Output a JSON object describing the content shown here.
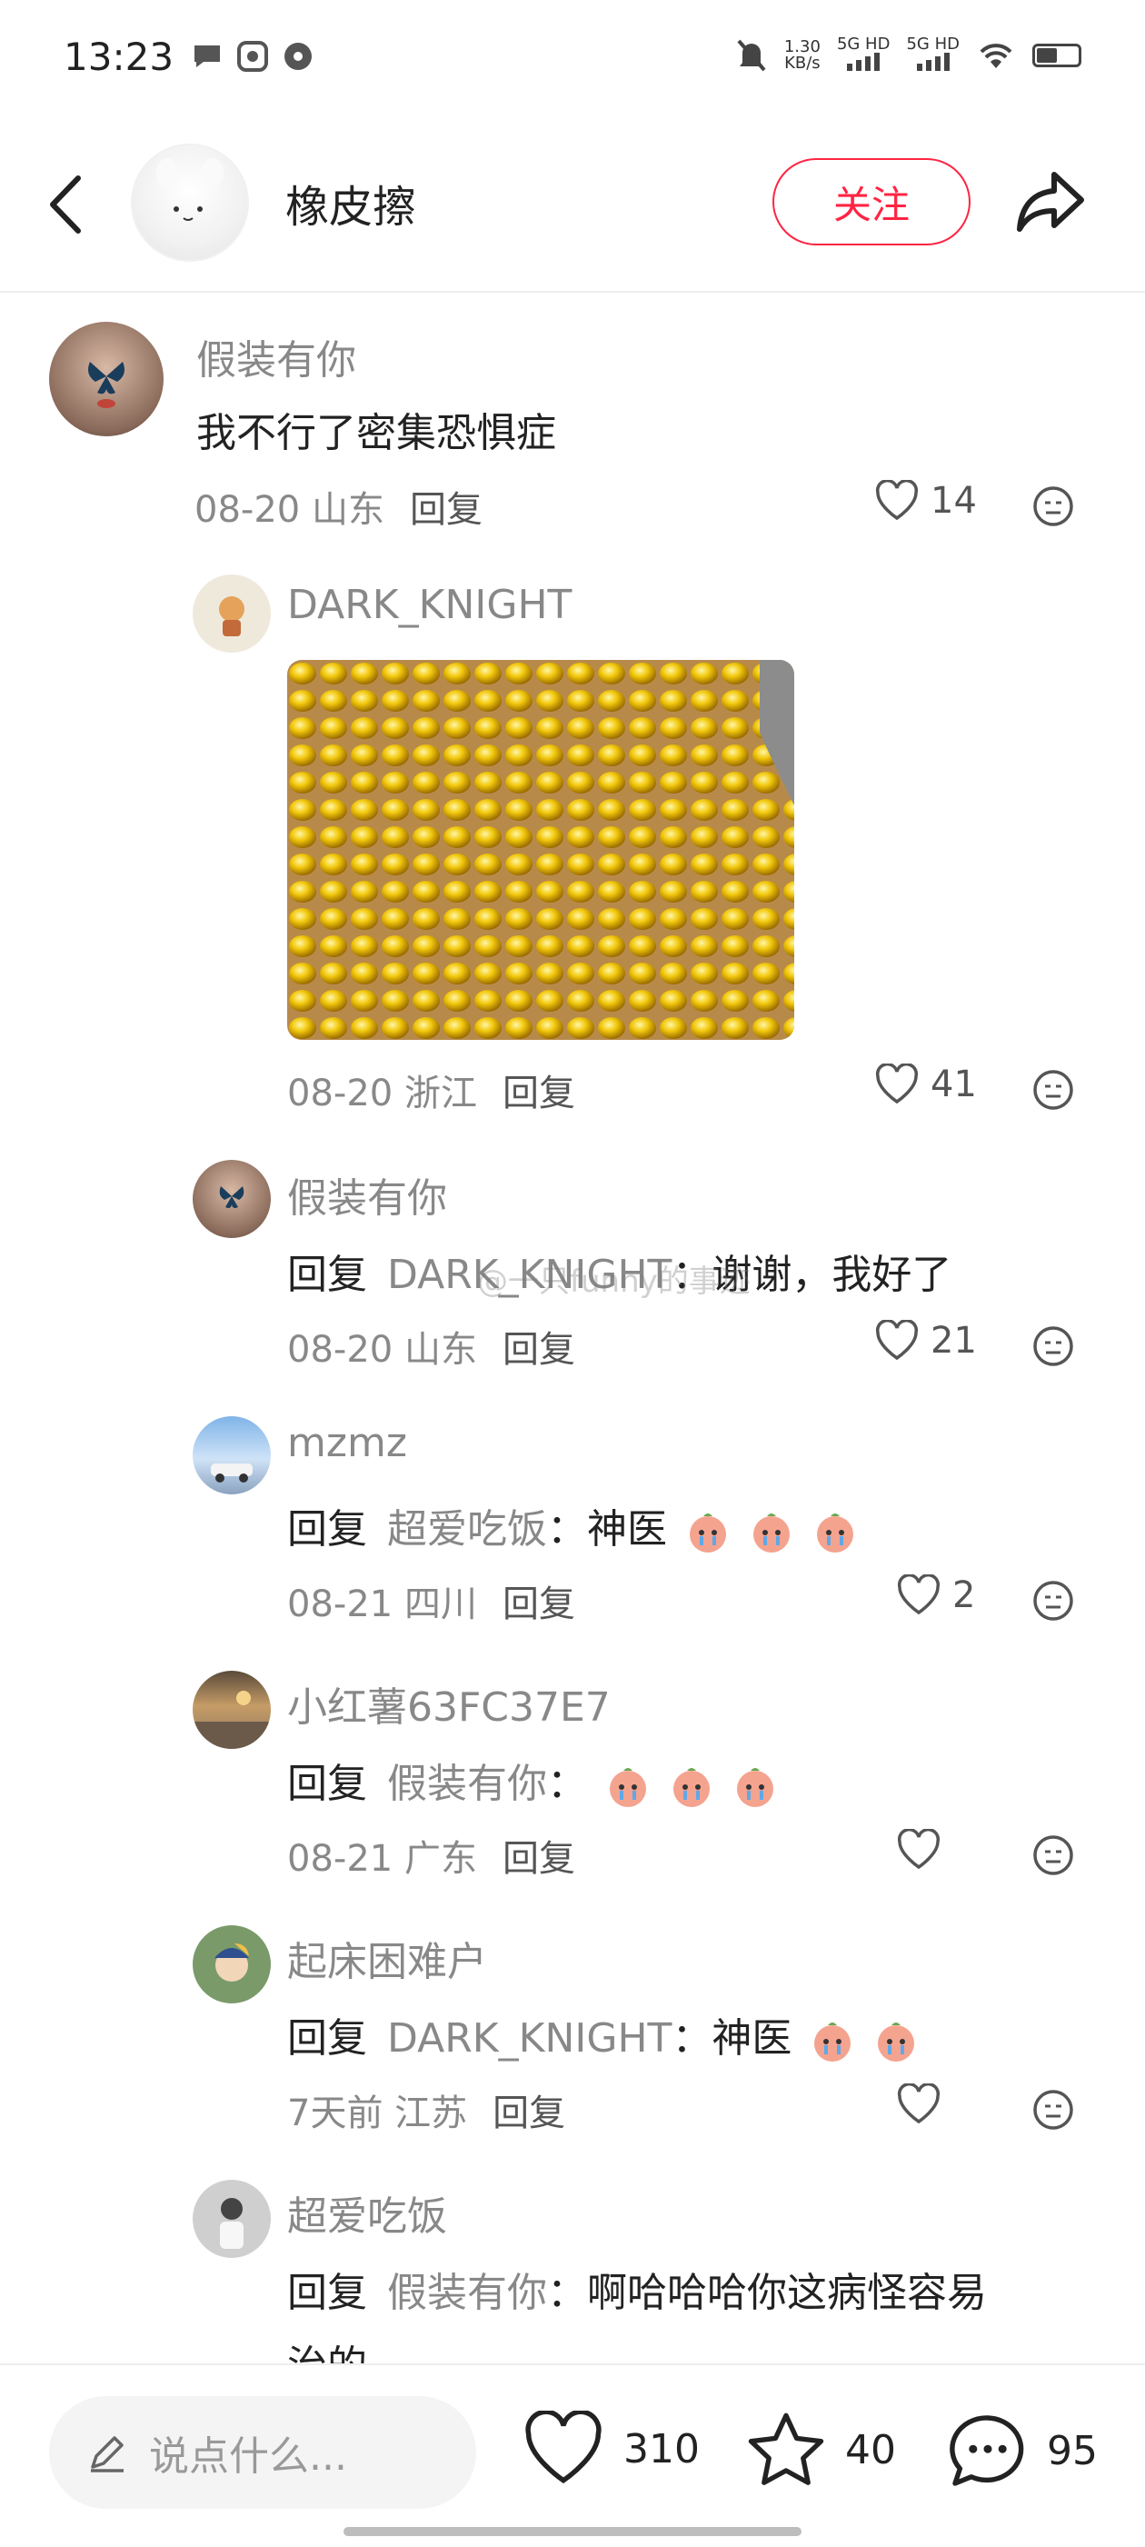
{
  "status_bar": {
    "time": "13:23",
    "speed_value": "1.30",
    "speed_unit": "KB/s",
    "net1": "5G HD",
    "net2": "5G HD",
    "battery_level": 0.45
  },
  "header": {
    "author_name": "橡皮擦",
    "follow_label": "关注"
  },
  "comments": [
    {
      "user": "假装有你",
      "text": "我不行了密集恐惧症",
      "date": "08-20",
      "location": "山东",
      "reply_label": "回复",
      "likes": "14"
    },
    {
      "user": "DARK_KNIGHT",
      "text": "",
      "date": "08-20",
      "location": "浙江",
      "reply_label": "回复",
      "likes": "41"
    },
    {
      "user": "假装有你",
      "reply_prefix": "回复",
      "reply_target": "DARK_KNIGHT",
      "text": "：谢谢，我好了",
      "date": "08-20",
      "location": "山东",
      "reply_label": "回复",
      "likes": "21"
    },
    {
      "user": "mzmz",
      "reply_prefix": "回复",
      "reply_target": "超爱吃饭",
      "text": "：神医",
      "date": "08-21",
      "location": "四川",
      "reply_label": "回复",
      "likes": "2"
    },
    {
      "user": "小红薯63FC37E7",
      "reply_prefix": "回复",
      "reply_target": "假装有你",
      "text": "：",
      "date": "08-21",
      "location": "广东",
      "reply_label": "回复",
      "likes": ""
    },
    {
      "user": "起床困难户",
      "reply_prefix": "回复",
      "reply_target": "DARK_KNIGHT",
      "text": "：神医",
      "date": "7天前",
      "location": "江苏",
      "reply_label": "回复",
      "likes": ""
    },
    {
      "user": "超爱吃饭",
      "reply_prefix": "回复",
      "reply_target": "假装有你",
      "text": "：啊哈哈哈你这病怪容易",
      "text2": "治的"
    }
  ],
  "watermark": "@一只funny的事迹",
  "bottom_bar": {
    "input_placeholder": "说点什么...",
    "likes": "310",
    "stars": "40",
    "comments": "95"
  },
  "colors": {
    "accent": "#ff2442",
    "secondary_text": "#888888"
  }
}
